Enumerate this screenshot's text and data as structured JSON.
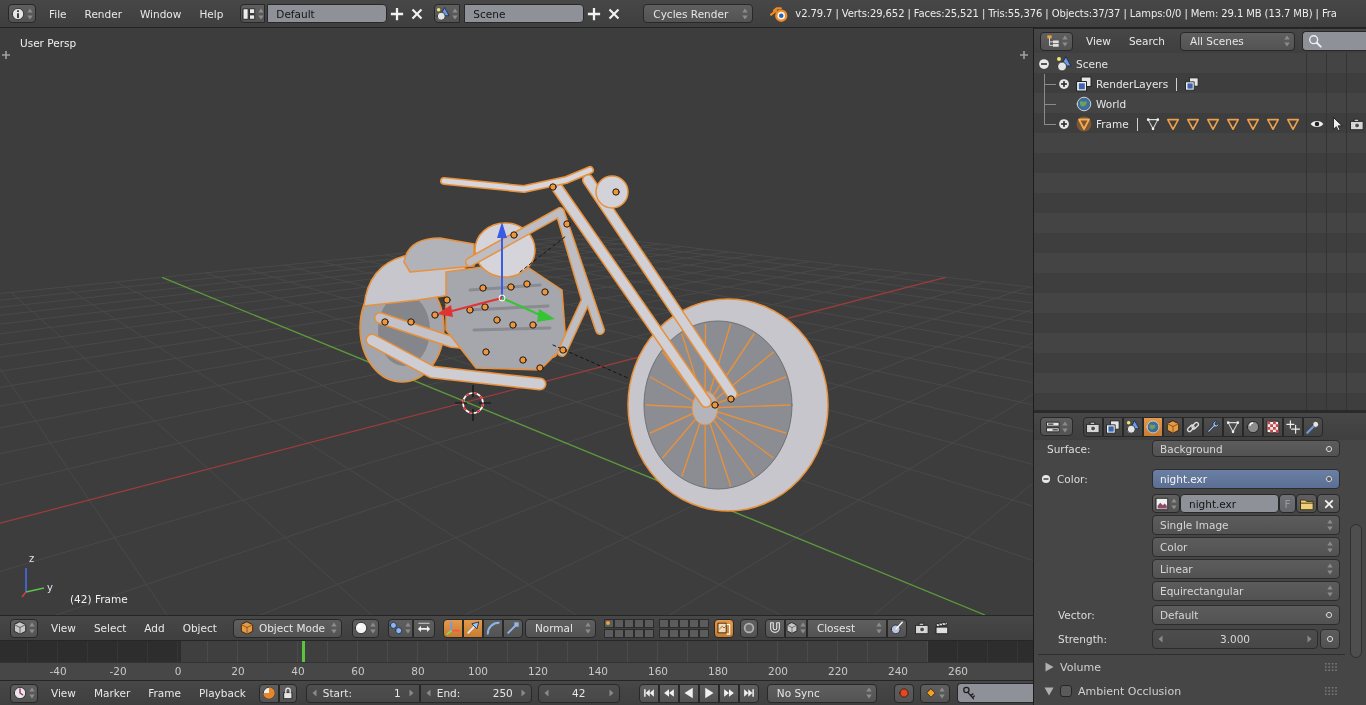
{
  "info_header": {
    "menus": [
      "File",
      "Render",
      "Window",
      "Help"
    ],
    "screen_layout": "Default",
    "scene": "Scene",
    "render_engine": "Cycles Render",
    "stats": "v2.79.7 | Verts:29,652 | Faces:25,521 | Tris:55,376 | Objects:37/37 | Lamps:0/0 | Mem: 29.1 MB (13.7 MB) | Fra"
  },
  "viewport": {
    "view_name": "User Persp",
    "object_info": "(42) Frame",
    "axis_labels": [
      "z",
      "y"
    ]
  },
  "view3d_header": {
    "menus": [
      "View",
      "Select",
      "Add",
      "Object"
    ],
    "mode": "Object Mode",
    "manipulators": [
      {
        "kind": "toggle",
        "on": true
      },
      {
        "kind": "translate",
        "on": true
      },
      {
        "kind": "rotate",
        "on": false
      },
      {
        "kind": "scale",
        "on": false
      }
    ],
    "orientation": "Normal",
    "layers": [
      {
        "used": true
      },
      {
        "used": false
      },
      {
        "used": false
      },
      {
        "used": false
      },
      {
        "used": false
      },
      {
        "used": false
      },
      {
        "used": false
      },
      {
        "used": false
      },
      {
        "used": false
      },
      {
        "used": false
      },
      {
        "used": false
      },
      {
        "used": false
      },
      {
        "used": false
      },
      {
        "used": false
      },
      {
        "used": false
      },
      {
        "used": false
      },
      {
        "used": false
      },
      {
        "used": false
      },
      {
        "used": false
      },
      {
        "used": false
      }
    ],
    "lock_layers": {
      "on": true
    },
    "proportional": {
      "on": false
    },
    "snap": {
      "on": false
    },
    "snap_target": "Closest"
  },
  "timeline": {
    "ticks": [
      "-40",
      "-20",
      "0",
      "20",
      "40",
      "60",
      "80",
      "100",
      "120",
      "140",
      "160",
      "180",
      "200",
      "220",
      "240",
      "260"
    ],
    "playhead": {
      "level": 0.293
    }
  },
  "timeline_header": {
    "menus": [
      "View",
      "Marker",
      "Frame",
      "Playback"
    ],
    "start": {
      "label": "Start:",
      "value": "1"
    },
    "end": {
      "label": "End:",
      "value": "250"
    },
    "current_frame": "42",
    "sync_mode": "No Sync"
  },
  "outliner": {
    "menus": [
      "View",
      "Search"
    ],
    "display_mode": "All Scenes",
    "tree": [
      {
        "label": "Scene",
        "kind": "scene",
        "expanded": true,
        "children": [
          {
            "label": "RenderLayers",
            "kind": "render_layers",
            "expanded": false,
            "inline": [
              {
                "kind": "render_layer"
              }
            ]
          },
          {
            "label": "World",
            "kind": "world"
          },
          {
            "label": "Frame",
            "kind": "object",
            "expanded": false,
            "inline": [
              {
                "kind": "mesh"
              },
              {
                "kind": "object"
              },
              {
                "kind": "object"
              },
              {
                "kind": "object"
              },
              {
                "kind": "object"
              },
              {
                "kind": "object"
              },
              {
                "kind": "object"
              },
              {
                "kind": "object"
              }
            ],
            "visible": true,
            "selectable": true,
            "renderable": true
          }
        ]
      }
    ]
  },
  "properties": {
    "tabs": [
      {
        "kind": "render",
        "selected": false
      },
      {
        "kind": "render_layers",
        "selected": false
      },
      {
        "kind": "scene",
        "selected": false
      },
      {
        "kind": "world",
        "selected": true
      },
      {
        "kind": "object",
        "selected": false
      },
      {
        "kind": "constraints",
        "selected": false
      },
      {
        "kind": "modifiers",
        "selected": false
      },
      {
        "kind": "data",
        "selected": false
      },
      {
        "kind": "material",
        "selected": false
      },
      {
        "kind": "texture",
        "selected": false
      },
      {
        "kind": "particles",
        "selected": false
      },
      {
        "kind": "physics",
        "selected": false
      }
    ],
    "rows": [
      {
        "kind": "socket",
        "label": "Surface:",
        "value": "Background"
      },
      {
        "kind": "linked",
        "label": "Color:",
        "value": "night.exr",
        "expanded": true
      },
      {
        "kind": "image",
        "name": "night.exr",
        "fake_user": "F"
      },
      {
        "kind": "menu",
        "value": "Single Image"
      },
      {
        "kind": "menu",
        "value": "Color"
      },
      {
        "kind": "menu",
        "value": "Linear"
      },
      {
        "kind": "menu",
        "value": "Equirectangular"
      },
      {
        "kind": "socket",
        "label": "Vector:",
        "value": "Default"
      },
      {
        "kind": "number",
        "label": "Strength:",
        "value": "3.000"
      }
    ],
    "panels": [
      {
        "title": "Volume",
        "expanded": false
      },
      {
        "title": "Ambient Occlusion",
        "expanded": true,
        "checked": false
      }
    ]
  }
}
